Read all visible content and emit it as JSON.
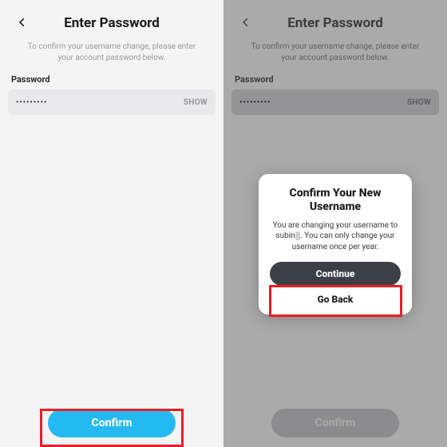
{
  "left": {
    "title": "Enter Password",
    "subtitle": "To confirm your username change, please enter your account password below.",
    "field_label": "Password",
    "password_masked": "•••••••••",
    "show_label": "SHOW",
    "confirm_label": "Confirm"
  },
  "right": {
    "title": "Enter Password",
    "subtitle": "To confirm your username change, please enter your account password below.",
    "field_label": "Password",
    "password_masked": "•••••••••",
    "show_label": "SHOW",
    "confirm_label": "Confirm",
    "modal": {
      "title_line1": "Confirm Your New",
      "title_line2": "Username",
      "body_prefix": "You are changing your username to subin",
      "body_masked": "   ",
      "body_suffix": ". You can only change your username once per year.",
      "continue_label": "Continue",
      "goback_label": "Go Back"
    }
  },
  "colors": {
    "accent": "#25b9f2",
    "highlight": "#ec1c24",
    "modal_button": "#3b3f47"
  }
}
